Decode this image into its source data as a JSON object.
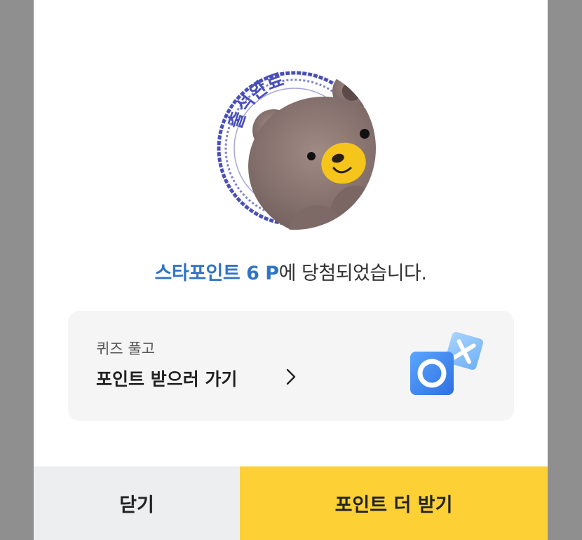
{
  "dialog": {
    "stamp": {
      "text": "출석완료",
      "icon": "bear-character-icon",
      "ring_color": "#4a4fb8"
    },
    "message": {
      "highlight": "스타포인트 6 P",
      "rest": "에 당첨되었습니다.",
      "highlight_color": "#2f74c4"
    },
    "quiz_card": {
      "subtitle": "퀴즈 풀고",
      "title": "포인트 받으러 가기",
      "chevron_icon": "chevron-right-icon",
      "icon": "ox-quiz-icon"
    },
    "buttons": {
      "close_label": "닫기",
      "more_points_label": "포인트 더 받기",
      "close_color": "#eceef0",
      "accent_color": "#fdd136"
    }
  }
}
